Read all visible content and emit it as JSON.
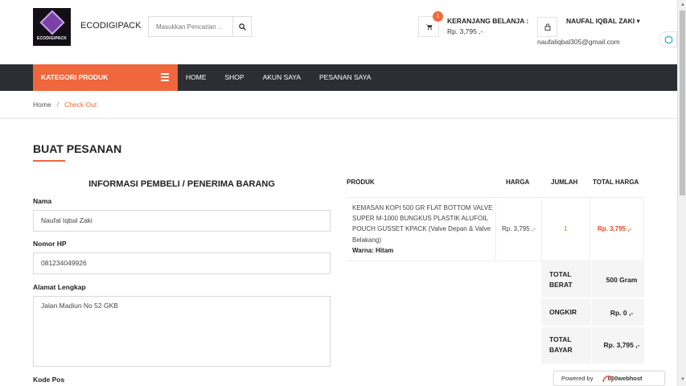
{
  "header": {
    "logo_text": "ECODIGIPACK",
    "brand": "ECODIGIPACK",
    "search_placeholder": "Masukkan Pencarian ..",
    "cart_badge": "1",
    "cart_title": "KERANJANG BELANJA :",
    "cart_value": "Rp. 3,795 ,-",
    "user_name": "NAUFAL IQBAL ZAKI",
    "user_email": "naufaliqbal305@gmail.com"
  },
  "nav": {
    "category_label": "KATEGORI PRODUK",
    "items": [
      "HOME",
      "SHOP",
      "AKUN SAYA",
      "PESANAN SAYA"
    ]
  },
  "breadcrumb": {
    "home": "Home",
    "sep": "/",
    "current": "Check Out"
  },
  "page": {
    "title": "BUAT PESANAN"
  },
  "form": {
    "section_title": "INFORMASI PEMBELI / PENERIMA BARANG",
    "name_label": "Nama",
    "name_value": "Naufal Iqbal Zaki",
    "phone_label": "Nomor HP",
    "phone_value": "081234049926",
    "address_label": "Alamat Lengkap",
    "address_value": "Jalan Madiun No 52 GKB",
    "zip_label": "Kode Pos"
  },
  "order": {
    "headers": {
      "product": "PRODUK",
      "price": "HARGA",
      "qty": "JUMLAH",
      "total": "TOTAL HARGA"
    },
    "item": {
      "name": "KEMASAN KOPI 500 GR FLAT BOTTOM VALVE SUPER M-1000 BUNGKUS PLASTIK ALUFOIL POUCH GUSSET KPACK (Valve Depan & Valve Belakang)",
      "variant": "Warna: Hitam",
      "price": "Rp. 3,795 ,-",
      "qty": "1",
      "total": "Rp. 3,795 ,-"
    },
    "summary": {
      "weight_label_1": "TOTAL",
      "weight_label_2": "BERAT",
      "weight_value": "500 Gram",
      "shipping_label": "ONGKIR",
      "shipping_value": "Rp. 0 ,-",
      "pay_label_1": "TOTAL",
      "pay_label_2": "BAYAR",
      "pay_value": "Rp. 3,795 ,-"
    }
  },
  "footer": {
    "powered": "Powered by",
    "host": "000webhost"
  },
  "colors": {
    "accent": "#f0663d",
    "nav": "#2c2e33",
    "summary_bg": "#f5f5f5"
  }
}
